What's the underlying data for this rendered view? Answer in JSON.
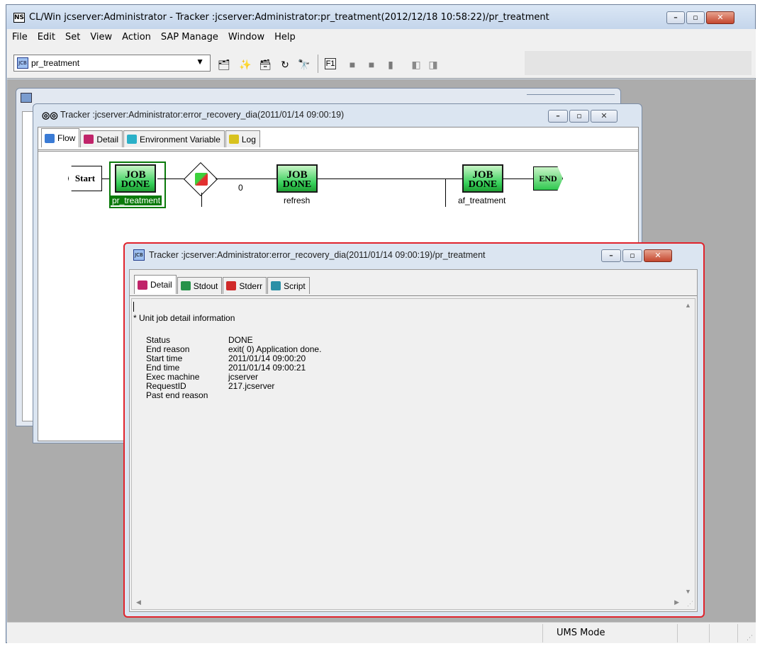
{
  "main": {
    "app_icon": "NS",
    "title": "CL/Win jcserver:Administrator - Tracker :jcserver:Administrator:pr_treatment(2012/12/18 10:58:22)/pr_treatment"
  },
  "menu": [
    "File",
    "Edit",
    "Set",
    "View",
    "Action",
    "SAP Manage",
    "Window",
    "Help"
  ],
  "toolbar": {
    "combo_icon": "JCB",
    "combo_value": "pr_treatment",
    "icons": [
      "open-icon",
      "wizard-icon",
      "properties-icon",
      "refresh-icon",
      "search-icon",
      "help-icon",
      "folder-icon",
      "folders-icon",
      "document-icon",
      "copy-icon",
      "paste-icon"
    ]
  },
  "tracker_window": {
    "title": "Tracker :jcserver:Administrator:error_recovery_dia(2011/01/14 09:00:19)",
    "tabs": [
      "Flow",
      "Detail",
      "Environment Variable",
      "Log"
    ],
    "flow": {
      "start": "Start",
      "end": "END",
      "branch_label": "0",
      "jobs": [
        {
          "line1": "JOB",
          "line2": "DONE",
          "label": "pr_treatment"
        },
        {
          "line1": "JOB",
          "line2": "DONE",
          "label": "refresh"
        },
        {
          "line1": "JOB",
          "line2": "DONE",
          "label": "af_treatment"
        }
      ]
    }
  },
  "job_window": {
    "icon": "JCB",
    "title": "Tracker :jcserver:Administrator:error_recovery_dia(2011/01/14 09:00:19)/pr_treatment",
    "tabs": [
      "Detail",
      "Stdout",
      "Stderr",
      "Script"
    ],
    "heading": "* Unit job detail information",
    "details": [
      {
        "key": "Status",
        "value": "DONE"
      },
      {
        "key": "End reason",
        "value": "exit( 0) Application done."
      },
      {
        "key": "Start time",
        "value": "2011/01/14 09:00:20"
      },
      {
        "key": "End time",
        "value": "2011/01/14 09:00:21"
      },
      {
        "key": "Exec machine",
        "value": "jcserver"
      },
      {
        "key": "RequestID",
        "value": "217.jcserver"
      },
      {
        "key": "Past end reason",
        "value": ""
      }
    ]
  },
  "statusbar": {
    "mode": "UMS Mode"
  }
}
